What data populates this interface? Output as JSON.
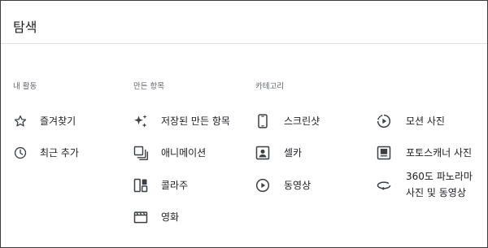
{
  "header": {
    "title": "탐색"
  },
  "sections": {
    "activity": {
      "title": "내 활동",
      "items": [
        {
          "label": "즐겨찾기",
          "icon": "star-outline-icon"
        },
        {
          "label": "최근 추가",
          "icon": "clock-icon"
        }
      ]
    },
    "creations": {
      "title": "만든 항목",
      "items": [
        {
          "label": "저장된 만든 항목",
          "icon": "sparkle-icon"
        },
        {
          "label": "애니메이션",
          "icon": "animation-stack-icon"
        },
        {
          "label": "콜라주",
          "icon": "collage-icon"
        },
        {
          "label": "영화",
          "icon": "movie-clapper-icon"
        }
      ]
    },
    "categories": {
      "title": "카테고리",
      "items": [
        {
          "label": "스크린샷",
          "icon": "phone-screenshot-icon"
        },
        {
          "label": "셀카",
          "icon": "selfie-portrait-icon"
        },
        {
          "label": "동영상",
          "icon": "play-circle-icon"
        }
      ]
    },
    "categories2": {
      "items": [
        {
          "label": "모션 사진",
          "icon": "motion-photo-icon"
        },
        {
          "label": "포토스캐너 사진",
          "icon": "photoscan-icon"
        },
        {
          "label_line1": "360도 파노라마",
          "label_line2": "사진 및 동영상",
          "icon": "panorama-360-icon"
        }
      ]
    }
  }
}
